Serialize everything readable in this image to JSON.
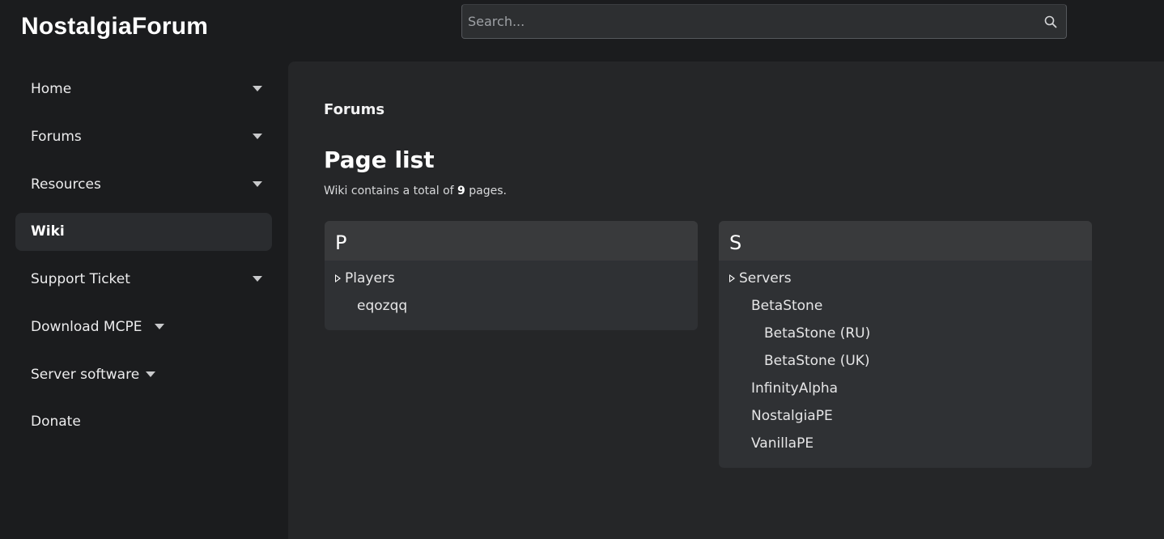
{
  "header": {
    "site_title": "NostalgiaForum",
    "search_placeholder": "Search..."
  },
  "sidebar": {
    "items": [
      {
        "label": "Home",
        "has_dropdown": true,
        "active": false
      },
      {
        "label": "Forums",
        "has_dropdown": true,
        "active": false
      },
      {
        "label": "Resources",
        "has_dropdown": true,
        "active": false
      },
      {
        "label": "Wiki",
        "has_dropdown": false,
        "active": true
      },
      {
        "label": "Support Ticket",
        "has_dropdown": true,
        "active": false
      },
      {
        "label": "Download MCPE",
        "has_dropdown": true,
        "active": false
      },
      {
        "label": "Server software",
        "has_dropdown": true,
        "active": false
      },
      {
        "label": "Donate",
        "has_dropdown": false,
        "active": false
      }
    ]
  },
  "main": {
    "breadcrumb": "Forums",
    "title": "Page list",
    "description_prefix": "Wiki contains a total of ",
    "page_count": "9",
    "description_suffix": " pages.",
    "groups": [
      {
        "letter": "P",
        "entries": [
          {
            "label": "Players",
            "expandable": true
          },
          {
            "label": "eqozqq",
            "expandable": false
          }
        ]
      },
      {
        "letter": "S",
        "entries": [
          {
            "label": "Servers",
            "expandable": true
          },
          {
            "label": "BetaStone",
            "expandable": false
          },
          {
            "label": "BetaStone (RU)",
            "expandable": false
          },
          {
            "label": "BetaStone (UK)",
            "expandable": false
          },
          {
            "label": "InfinityAlpha",
            "expandable": false
          },
          {
            "label": "NostalgiaPE",
            "expandable": false
          },
          {
            "label": "VanillaPE",
            "expandable": false
          }
        ]
      }
    ]
  },
  "colors": {
    "page_bg": "#1b1c1e",
    "content_bg": "#252628",
    "card_bg": "#2f3134",
    "card_header_bg": "#393a3c",
    "active_nav_bg": "#2a2c2f"
  }
}
